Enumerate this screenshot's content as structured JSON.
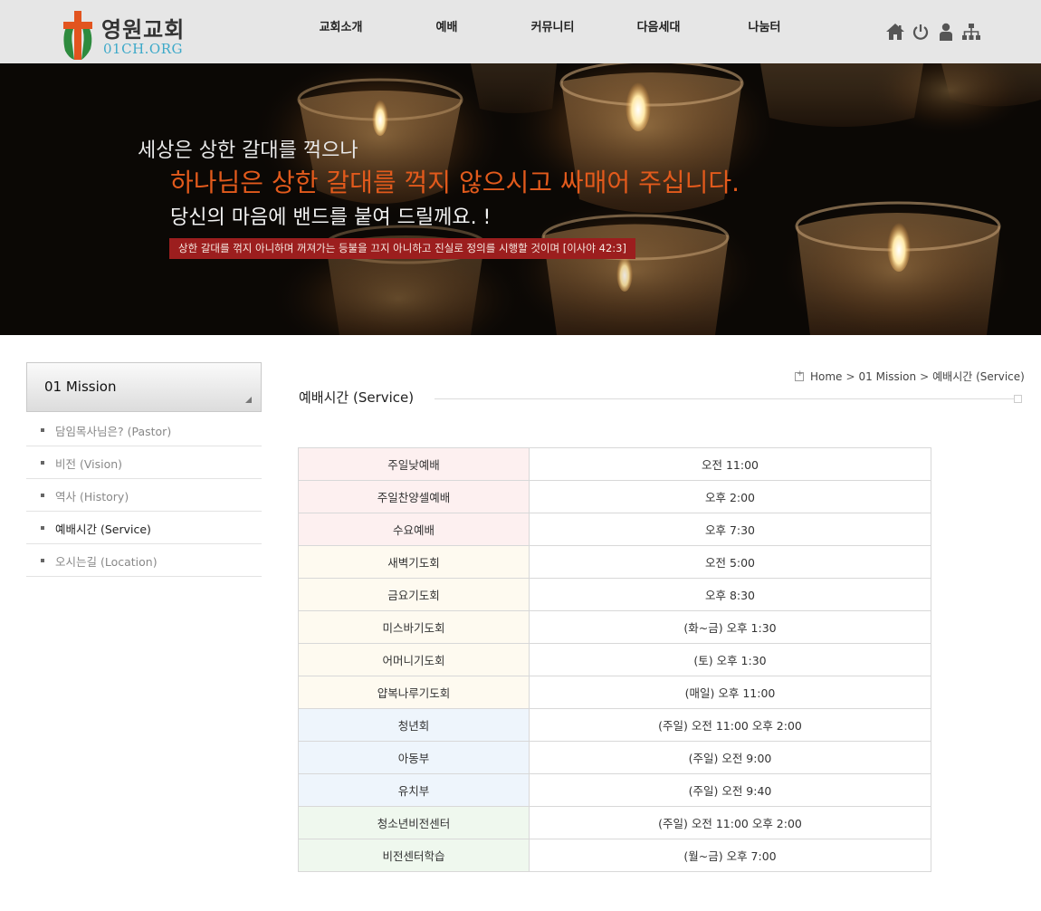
{
  "header": {
    "logo_name": "영원교회",
    "logo_domain": "01CH.ORG",
    "nav": [
      "교회소개",
      "예배",
      "커뮤니티",
      "다음세대",
      "나눔터"
    ],
    "util_icons": [
      "home-icon",
      "power-icon",
      "user-icon",
      "sitemap-icon"
    ]
  },
  "banner": {
    "line1": "세상은 상한 갈대를 꺽으나",
    "line2": "하나님은 상한 갈대를 꺽지 않으시고 싸매어 주십니다.",
    "line3": "당신의 마음에 밴드를 붙여 드릴께요. !",
    "verse": "상한 갈대를 꺾지 아니하며 꺼져가는 등불을 끄지 아니하고 진실로 정의를 시행할 것이며 [이사야 42:3]"
  },
  "sidebar": {
    "title": "01 Mission",
    "items": [
      {
        "label": "담임목사님은? (Pastor)"
      },
      {
        "label": "비전 (Vision)"
      },
      {
        "label": "역사 (History)"
      },
      {
        "label": "예배시간 (Service)"
      },
      {
        "label": "오시는길 (Location)"
      }
    ],
    "active_index": 3
  },
  "content": {
    "breadcrumb": [
      "Home",
      "01 Mission",
      "예배시간 (Service)"
    ],
    "title": "예배시간 (Service)",
    "services": [
      {
        "name": "주일낮예배",
        "time": "오전 11:00",
        "group": "pink"
      },
      {
        "name": "주일찬양셀예배",
        "time": "오후 2:00",
        "group": "pink"
      },
      {
        "name": "수요예배",
        "time": "오후 7:30",
        "group": "pink"
      },
      {
        "name": "새벽기도회",
        "time": "오전 5:00",
        "group": "cream"
      },
      {
        "name": "금요기도회",
        "time": "오후 8:30",
        "group": "cream"
      },
      {
        "name": "미스바기도회",
        "time": "(화~금) 오후 1:30",
        "group": "cream"
      },
      {
        "name": "어머니기도회",
        "time": "(토) 오후 1:30",
        "group": "cream"
      },
      {
        "name": "얍복나루기도회",
        "time": "(매일) 오후 11:00",
        "group": "cream"
      },
      {
        "name": "청년회",
        "time": "(주일) 오전 11:00 오후 2:00",
        "group": "blue"
      },
      {
        "name": "아동부",
        "time": "(주일) 오전 9:00",
        "group": "blue"
      },
      {
        "name": "유치부",
        "time": "(주일) 오전 9:40",
        "group": "blue"
      },
      {
        "name": "청소년비전센터",
        "time": "(주일) 오전 11:00 오후 2:00",
        "group": "green"
      },
      {
        "name": "비전센터학습",
        "time": "(월~금) 오후 7:00",
        "group": "green"
      }
    ]
  },
  "colors": {
    "header_bg": "#e6e6e6",
    "logo_domain": "#3da9c9",
    "banner_highlight": "#e25a1c",
    "verse_bg": "#9c1e1e"
  }
}
